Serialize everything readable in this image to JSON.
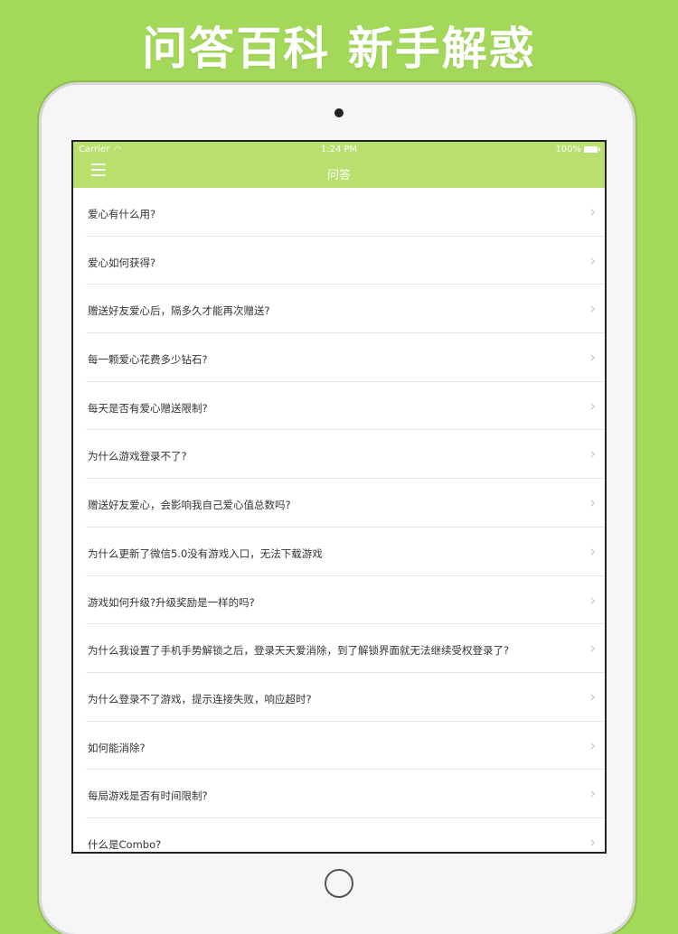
{
  "promo": {
    "title": "问答百科 新手解惑"
  },
  "status_bar": {
    "carrier": "Carrier",
    "time": "1:24 PM",
    "battery": "100%"
  },
  "nav": {
    "title": "问答"
  },
  "list": {
    "items": [
      {
        "label": "爱心有什么用?"
      },
      {
        "label": "爱心如何获得?"
      },
      {
        "label": "赠送好友爱心后，隔多久才能再次赠送?"
      },
      {
        "label": "每一颗爱心花费多少钻石?"
      },
      {
        "label": "每天是否有爱心赠送限制?"
      },
      {
        "label": "为什么游戏登录不了?"
      },
      {
        "label": "赠送好友爱心，会影响我自己爱心值总数吗?"
      },
      {
        "label": "为什么更新了微信5.0没有游戏入口，无法下载游戏"
      },
      {
        "label": "游戏如何升级?升级奖励是一样的吗?"
      },
      {
        "label": "为什么我设置了手机手势解锁之后，登录天天爱消除，到了解锁界面就无法继续受权登录了?"
      },
      {
        "label": "为什么登录不了游戏，提示连接失败，响应超时?"
      },
      {
        "label": "如何能消除?"
      },
      {
        "label": "每局游戏是否有时间限制?"
      },
      {
        "label": "什么是Combo?"
      }
    ]
  },
  "colors": {
    "background": "#a4d85a",
    "nav_bar": "#b9e06e",
    "chevron": "#c7c7cc"
  },
  "icons": {
    "menu": "hamburger-menu-icon",
    "chevron": "chevron-right-icon",
    "wifi": "wifi-icon",
    "battery": "battery-icon"
  }
}
